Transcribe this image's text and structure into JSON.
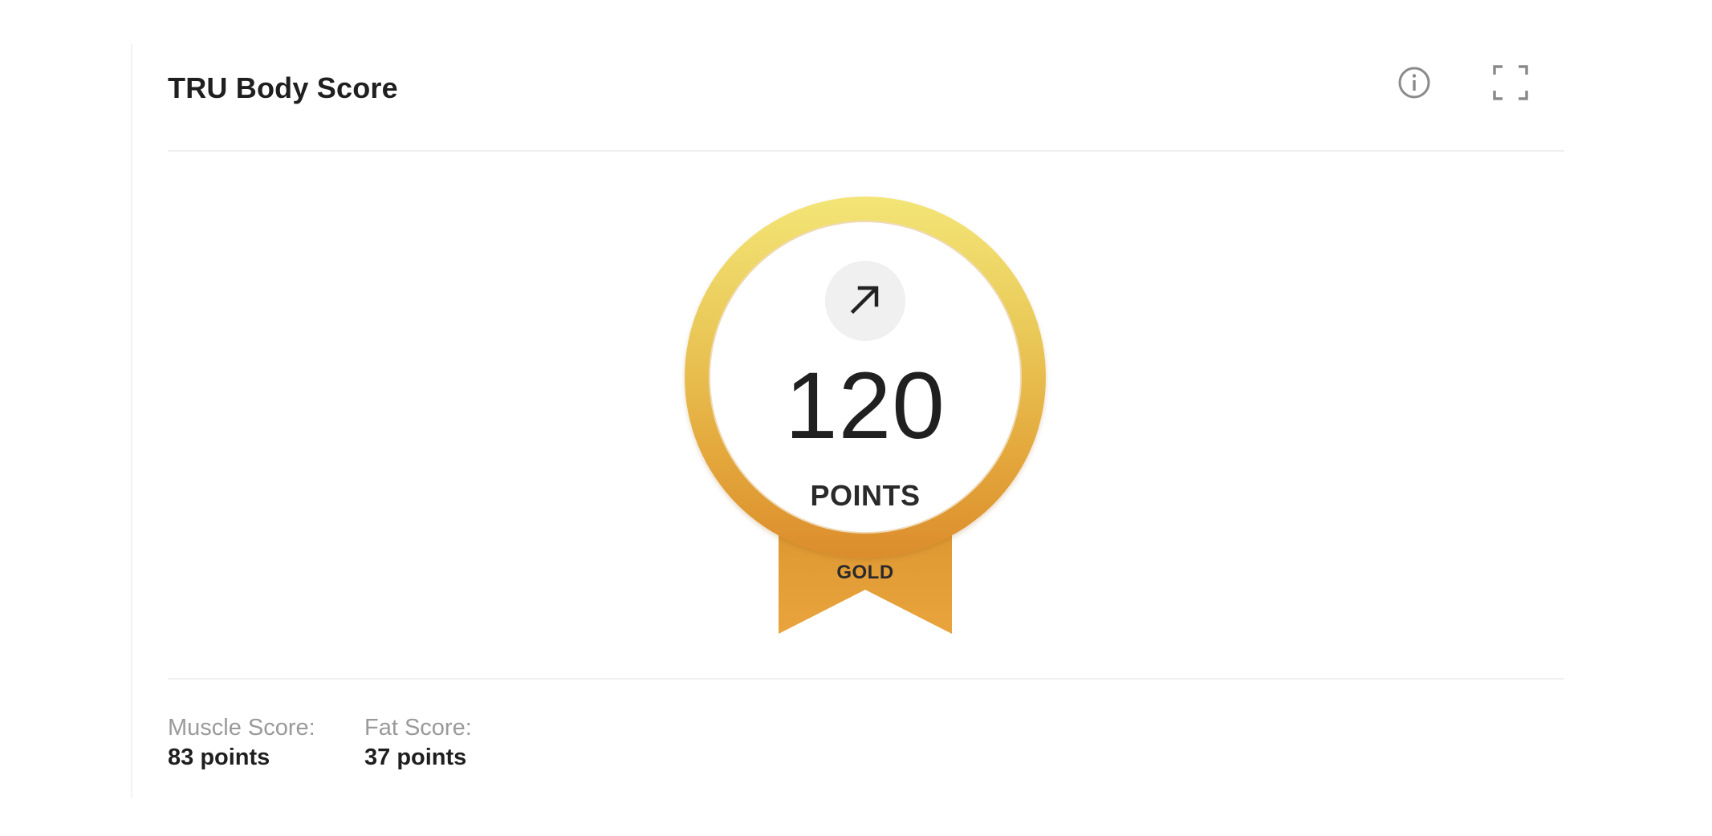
{
  "card": {
    "title": "TRU Body Score",
    "icons": {
      "info": "info-icon",
      "expand": "expand-icon"
    }
  },
  "score": {
    "trend_icon": "arrow-up-right-icon",
    "value": "120",
    "unit": "POINTS",
    "tier": "GOLD"
  },
  "breakdown": {
    "muscle": {
      "label": "Muscle Score:",
      "value": "83 points"
    },
    "fat": {
      "label": "Fat Score:",
      "value": "37 points"
    }
  },
  "colors": {
    "medal_top": "#f3e577",
    "medal_bottom": "#dc8d2c",
    "ribbon": "#e6a43c",
    "icon_gray": "#8a8a8a"
  }
}
